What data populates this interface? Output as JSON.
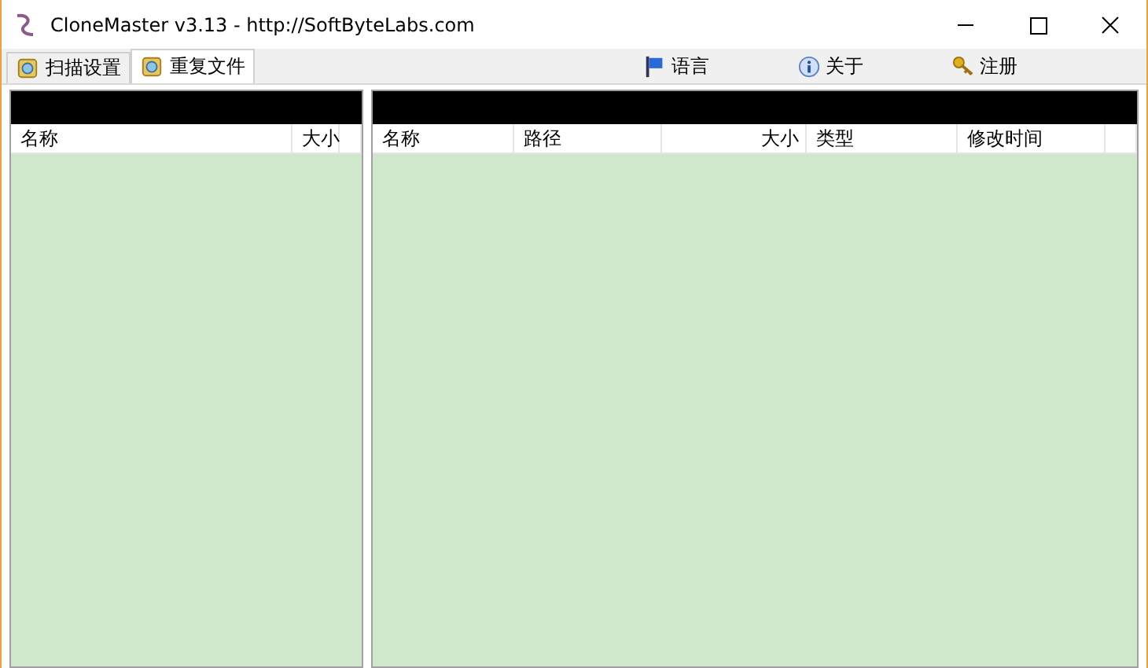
{
  "window": {
    "title": "CloneMaster v3.13 - http://SoftByteLabs.com"
  },
  "tabs": [
    {
      "label": "扫描设置",
      "selected": false
    },
    {
      "label": "重复文件",
      "selected": true
    }
  ],
  "toolbar": [
    {
      "label": "语言",
      "kind": "flag"
    },
    {
      "label": "关于",
      "kind": "info"
    },
    {
      "label": "注册",
      "kind": "key"
    }
  ],
  "left_list": {
    "columns": [
      {
        "label": "名称",
        "kind": "text"
      },
      {
        "label": "大小",
        "kind": "number"
      }
    ]
  },
  "right_list": {
    "columns": [
      {
        "label": "名称",
        "kind": "text"
      },
      {
        "label": "路径",
        "kind": "text"
      },
      {
        "label": "大小",
        "kind": "number"
      },
      {
        "label": "类型",
        "kind": "text"
      },
      {
        "label": "修改时间",
        "kind": "text"
      }
    ]
  }
}
